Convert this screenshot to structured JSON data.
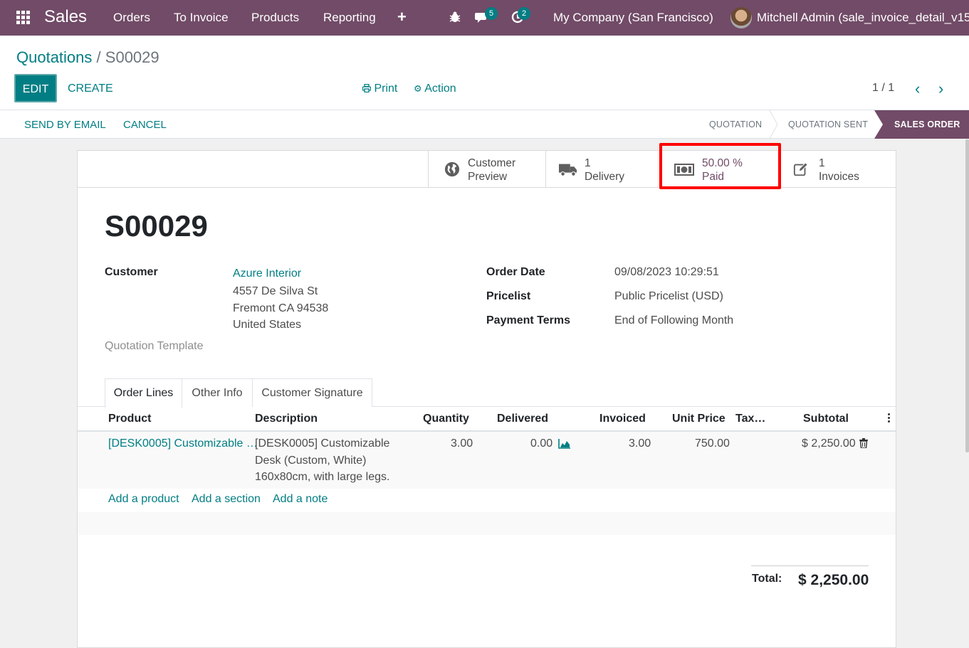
{
  "navbar": {
    "app_name": "Sales",
    "menu": [
      "Orders",
      "To Invoice",
      "Products",
      "Reporting"
    ],
    "messages_count": "5",
    "activities_count": "2",
    "company": "My Company (San Francisco)",
    "user": "Mitchell Admin (sale_invoice_detail_v15)",
    "bar_color": "#714b67"
  },
  "breadcrumb": {
    "parent": "Quotations",
    "separator": "/",
    "current": "S00029"
  },
  "buttons": {
    "edit": "EDIT",
    "create": "CREATE",
    "print": "Print",
    "action": "Action",
    "send_by_email": "SEND BY EMAIL",
    "cancel": "CANCEL"
  },
  "pager": {
    "value": "1 / 1"
  },
  "stages": {
    "quotation": "QUOTATION",
    "quotation_sent": "QUOTATION SENT",
    "sales_order": "SALES ORDER",
    "active": "sales_order"
  },
  "smart_buttons": {
    "preview": {
      "line1": "Customer",
      "line2": "Preview",
      "icon": "globe-icon"
    },
    "delivery": {
      "line1": "1",
      "line2": "Delivery",
      "icon": "truck-icon"
    },
    "paid": {
      "line1": "50.00 %",
      "line2": "Paid",
      "icon": "money-icon"
    },
    "invoices": {
      "line1": "1",
      "line2": "Invoices",
      "icon": "edit-icon"
    }
  },
  "order": {
    "name": "S00029",
    "customer_label": "Customer",
    "customer_name": "Azure Interior",
    "address_line1": "4557 De Silva St",
    "address_line2": "Fremont CA 94538",
    "address_line3": "United States",
    "quotation_template_label": "Quotation Template",
    "order_date_label": "Order Date",
    "order_date": "09/08/2023 10:29:51",
    "pricelist_label": "Pricelist",
    "pricelist": "Public Pricelist (USD)",
    "payment_terms_label": "Payment Terms",
    "payment_terms": "End of Following Month"
  },
  "tabs": [
    "Order Lines",
    "Other Info",
    "Customer Signature"
  ],
  "table": {
    "columns": [
      "Product",
      "Description",
      "Quantity",
      "Delivered",
      "Invoiced",
      "Unit Price",
      "Tax…",
      "Subtotal"
    ],
    "row": {
      "product": "[DESK0005] Customizable …",
      "description_l1": "[DESK0005] Customizable",
      "description_l2": "Desk (Custom, White)",
      "description_l3": "160x80cm, with large legs.",
      "quantity": "3.00",
      "delivered": "0.00",
      "invoiced": "3.00",
      "unit_price": "750.00",
      "subtotal": "$ 2,250.00"
    },
    "add_product": "Add a product",
    "add_section": "Add a section",
    "add_note": "Add a note"
  },
  "totals": {
    "label": "Total:",
    "value": "$ 2,250.00"
  },
  "colors": {
    "primary": "#714b67",
    "accent": "#017e84",
    "highlight": "#ff0000"
  }
}
